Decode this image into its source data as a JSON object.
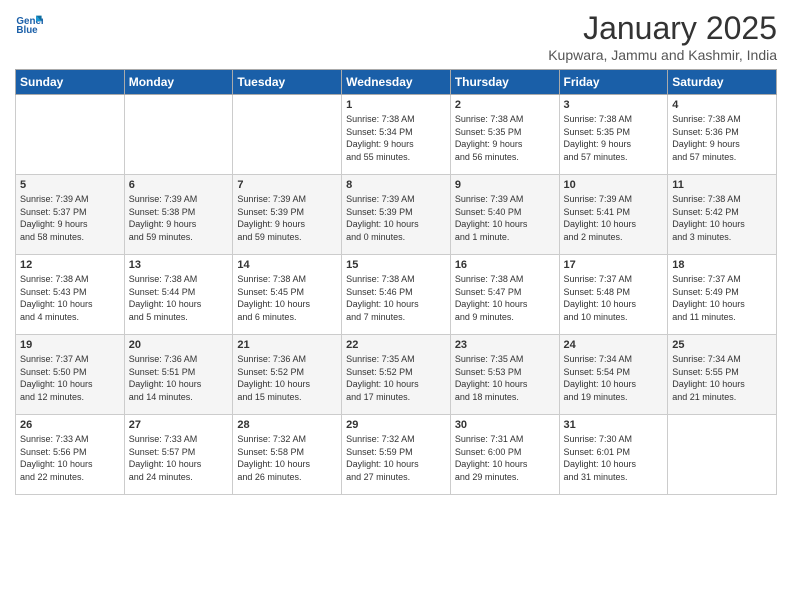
{
  "header": {
    "logo_general": "General",
    "logo_blue": "Blue",
    "month_title": "January 2025",
    "location": "Kupwara, Jammu and Kashmir, India"
  },
  "weekdays": [
    "Sunday",
    "Monday",
    "Tuesday",
    "Wednesday",
    "Thursday",
    "Friday",
    "Saturday"
  ],
  "weeks": [
    [
      {
        "day": "",
        "info": ""
      },
      {
        "day": "",
        "info": ""
      },
      {
        "day": "",
        "info": ""
      },
      {
        "day": "1",
        "info": "Sunrise: 7:38 AM\nSunset: 5:34 PM\nDaylight: 9 hours\nand 55 minutes."
      },
      {
        "day": "2",
        "info": "Sunrise: 7:38 AM\nSunset: 5:35 PM\nDaylight: 9 hours\nand 56 minutes."
      },
      {
        "day": "3",
        "info": "Sunrise: 7:38 AM\nSunset: 5:35 PM\nDaylight: 9 hours\nand 57 minutes."
      },
      {
        "day": "4",
        "info": "Sunrise: 7:38 AM\nSunset: 5:36 PM\nDaylight: 9 hours\nand 57 minutes."
      }
    ],
    [
      {
        "day": "5",
        "info": "Sunrise: 7:39 AM\nSunset: 5:37 PM\nDaylight: 9 hours\nand 58 minutes."
      },
      {
        "day": "6",
        "info": "Sunrise: 7:39 AM\nSunset: 5:38 PM\nDaylight: 9 hours\nand 59 minutes."
      },
      {
        "day": "7",
        "info": "Sunrise: 7:39 AM\nSunset: 5:39 PM\nDaylight: 9 hours\nand 59 minutes."
      },
      {
        "day": "8",
        "info": "Sunrise: 7:39 AM\nSunset: 5:39 PM\nDaylight: 10 hours\nand 0 minutes."
      },
      {
        "day": "9",
        "info": "Sunrise: 7:39 AM\nSunset: 5:40 PM\nDaylight: 10 hours\nand 1 minute."
      },
      {
        "day": "10",
        "info": "Sunrise: 7:39 AM\nSunset: 5:41 PM\nDaylight: 10 hours\nand 2 minutes."
      },
      {
        "day": "11",
        "info": "Sunrise: 7:38 AM\nSunset: 5:42 PM\nDaylight: 10 hours\nand 3 minutes."
      }
    ],
    [
      {
        "day": "12",
        "info": "Sunrise: 7:38 AM\nSunset: 5:43 PM\nDaylight: 10 hours\nand 4 minutes."
      },
      {
        "day": "13",
        "info": "Sunrise: 7:38 AM\nSunset: 5:44 PM\nDaylight: 10 hours\nand 5 minutes."
      },
      {
        "day": "14",
        "info": "Sunrise: 7:38 AM\nSunset: 5:45 PM\nDaylight: 10 hours\nand 6 minutes."
      },
      {
        "day": "15",
        "info": "Sunrise: 7:38 AM\nSunset: 5:46 PM\nDaylight: 10 hours\nand 7 minutes."
      },
      {
        "day": "16",
        "info": "Sunrise: 7:38 AM\nSunset: 5:47 PM\nDaylight: 10 hours\nand 9 minutes."
      },
      {
        "day": "17",
        "info": "Sunrise: 7:37 AM\nSunset: 5:48 PM\nDaylight: 10 hours\nand 10 minutes."
      },
      {
        "day": "18",
        "info": "Sunrise: 7:37 AM\nSunset: 5:49 PM\nDaylight: 10 hours\nand 11 minutes."
      }
    ],
    [
      {
        "day": "19",
        "info": "Sunrise: 7:37 AM\nSunset: 5:50 PM\nDaylight: 10 hours\nand 12 minutes."
      },
      {
        "day": "20",
        "info": "Sunrise: 7:36 AM\nSunset: 5:51 PM\nDaylight: 10 hours\nand 14 minutes."
      },
      {
        "day": "21",
        "info": "Sunrise: 7:36 AM\nSunset: 5:52 PM\nDaylight: 10 hours\nand 15 minutes."
      },
      {
        "day": "22",
        "info": "Sunrise: 7:35 AM\nSunset: 5:52 PM\nDaylight: 10 hours\nand 17 minutes."
      },
      {
        "day": "23",
        "info": "Sunrise: 7:35 AM\nSunset: 5:53 PM\nDaylight: 10 hours\nand 18 minutes."
      },
      {
        "day": "24",
        "info": "Sunrise: 7:34 AM\nSunset: 5:54 PM\nDaylight: 10 hours\nand 19 minutes."
      },
      {
        "day": "25",
        "info": "Sunrise: 7:34 AM\nSunset: 5:55 PM\nDaylight: 10 hours\nand 21 minutes."
      }
    ],
    [
      {
        "day": "26",
        "info": "Sunrise: 7:33 AM\nSunset: 5:56 PM\nDaylight: 10 hours\nand 22 minutes."
      },
      {
        "day": "27",
        "info": "Sunrise: 7:33 AM\nSunset: 5:57 PM\nDaylight: 10 hours\nand 24 minutes."
      },
      {
        "day": "28",
        "info": "Sunrise: 7:32 AM\nSunset: 5:58 PM\nDaylight: 10 hours\nand 26 minutes."
      },
      {
        "day": "29",
        "info": "Sunrise: 7:32 AM\nSunset: 5:59 PM\nDaylight: 10 hours\nand 27 minutes."
      },
      {
        "day": "30",
        "info": "Sunrise: 7:31 AM\nSunset: 6:00 PM\nDaylight: 10 hours\nand 29 minutes."
      },
      {
        "day": "31",
        "info": "Sunrise: 7:30 AM\nSunset: 6:01 PM\nDaylight: 10 hours\nand 31 minutes."
      },
      {
        "day": "",
        "info": ""
      }
    ]
  ]
}
